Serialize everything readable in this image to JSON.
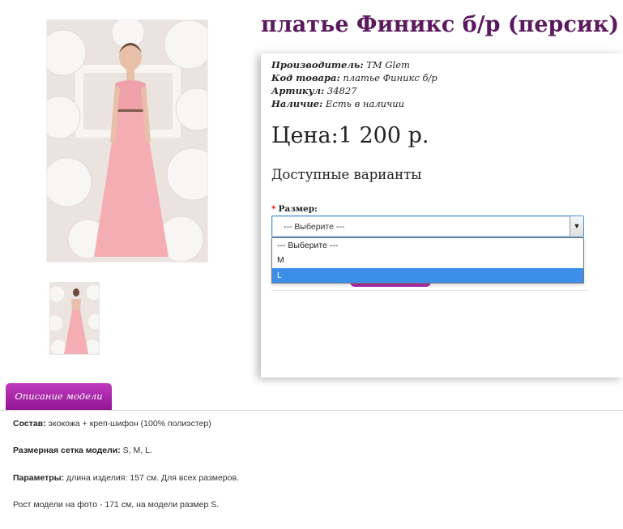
{
  "product": {
    "title": "платье Финикс б/р (персик)",
    "meta": [
      {
        "label": "Производитель:",
        "value": "TM Glem"
      },
      {
        "label": "Код товара:",
        "value": "платье Финикс б/р"
      },
      {
        "label": "Артикул:",
        "value": "34827"
      },
      {
        "label": "Наличие:",
        "value": "Есть в наличии"
      }
    ],
    "price": "Цена:1 200 р.",
    "options_heading": "Доступные варианты"
  },
  "size_select": {
    "required_mark": "*",
    "label": "Размер:",
    "value": "--- Выберите ---",
    "arrow": "▼",
    "options": [
      "--- Выберите ---",
      "M",
      "L"
    ],
    "highlighted": "L"
  },
  "tabs": [
    "Описание модели"
  ],
  "description": [
    {
      "label": "Состав:",
      "text": " экокожа + креп-шифон (100% полиэстер)"
    },
    {
      "label": "Размерная сетка модели:",
      "text": " S, M, L."
    },
    {
      "label": "Параметры:",
      "text": " длина изделия: 157 см. Для всех размеров."
    },
    {
      "label": "",
      "text": "Рост модели на фото - 171 см, на модели размер S."
    }
  ],
  "colors": {
    "title": "#5b1a5e",
    "tab": "#a726a8",
    "highlight": "#3d8ee8",
    "dress": "#f2a8ae"
  }
}
